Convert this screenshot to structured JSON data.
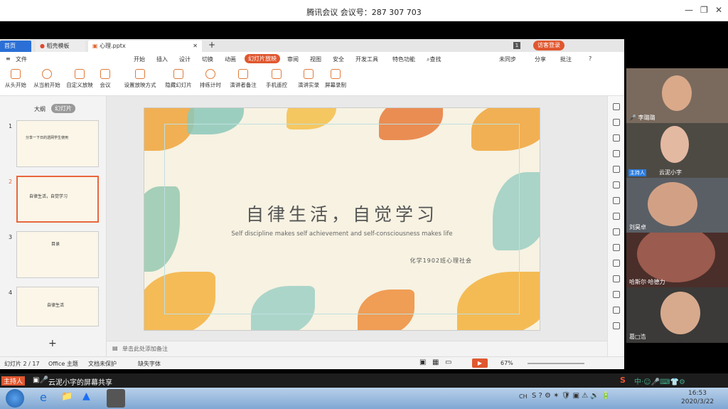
{
  "window": {
    "title": "腾讯会议 会议号：287 307 703"
  },
  "tabs": [
    {
      "label": "首页"
    },
    {
      "label": "稻壳模板"
    },
    {
      "label": "心理.pptx"
    }
  ],
  "login_button": "访客登录",
  "menu": [
    "文件",
    "开始",
    "插入",
    "设计",
    "切换",
    "动画",
    "幻灯片放映",
    "审阅",
    "视图",
    "安全",
    "开发工具",
    "特色功能",
    "查找"
  ],
  "menu_right": {
    "sync": "未同步",
    "share": "分享",
    "comment": "批注"
  },
  "ribbon": [
    "从头开始",
    "从当前开始",
    "自定义放映",
    "会议",
    "设置放映方式",
    "隐藏幻灯片",
    "排练计时",
    "演讲者备注",
    "手机遥控",
    "演讲实录",
    "屏幕录制"
  ],
  "panel_tabs": {
    "outline": "大纲",
    "slides": "幻灯片"
  },
  "thumbnails": [
    {
      "num": "1",
      "text": "分享一下日的透网学生使用"
    },
    {
      "num": "2",
      "text": "自律生活，自觉学习"
    },
    {
      "num": "3",
      "text": "目录"
    },
    {
      "num": "4",
      "text": "自律生活"
    }
  ],
  "slide": {
    "title": "自律生活，自觉学习",
    "subtitle": "Self discipline makes self achievement and self-consciousness makes life",
    "club": "化学1902班心理社会"
  },
  "notes_placeholder": "单击此处添加备注",
  "status": {
    "slide": "幻灯片 2 / 17",
    "theme": "Office 主题",
    "protect": "文档未保护",
    "font": "缺失字体",
    "zoom": "67%"
  },
  "participants": [
    {
      "name": "李璐璐"
    },
    {
      "name": "云泥小字",
      "role": "主持人"
    },
    {
      "name": "刘昊卓"
    },
    {
      "name": "哈斯尔·哈德力"
    },
    {
      "name": "葛□浩"
    }
  ],
  "share_bar": {
    "role": "主持人",
    "text": "云泥小字的屏幕共享"
  },
  "taskbar": {
    "time": "16:53",
    "date": "2020/3/22",
    "lang": "CH"
  }
}
